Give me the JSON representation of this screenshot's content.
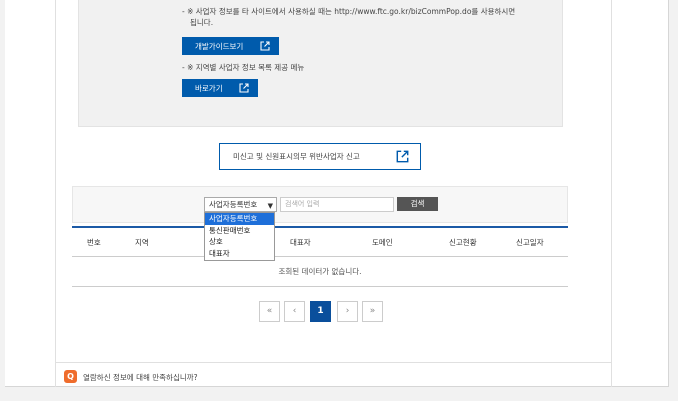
{
  "notices": {
    "item1_line1": "- ※ 사업자 정보를 타 사이트에서 사용하실 때는 http://www.ftc.go.kr/bizCommPop.do를 사용하시면",
    "item1_line2": "됩니다.",
    "guide_button": "개발가이드보기",
    "item2": "- ※ 지역별 사업자 정보 목록 제공 메뉴",
    "shortcut_button": "바로가기"
  },
  "report_button": "미신고 및 신원표시의무 위반사업자 신고",
  "search": {
    "selected": "사업자등록번호",
    "placeholder": "검색어 입력",
    "button": "검색",
    "options": [
      "사업자등록번호",
      "통신판매번호",
      "상호",
      "대표자"
    ]
  },
  "table": {
    "headers": [
      "번호",
      "지역",
      "대표자",
      "도메인",
      "신고현황",
      "신고일자"
    ],
    "empty": "조회된 데이터가 없습니다."
  },
  "pagination": {
    "first": "«",
    "prev": "‹",
    "current": "1",
    "next": "›",
    "last": "»"
  },
  "survey": {
    "icon": "Q",
    "text": "열람하신 정보에 대해 만족하십니까?"
  }
}
